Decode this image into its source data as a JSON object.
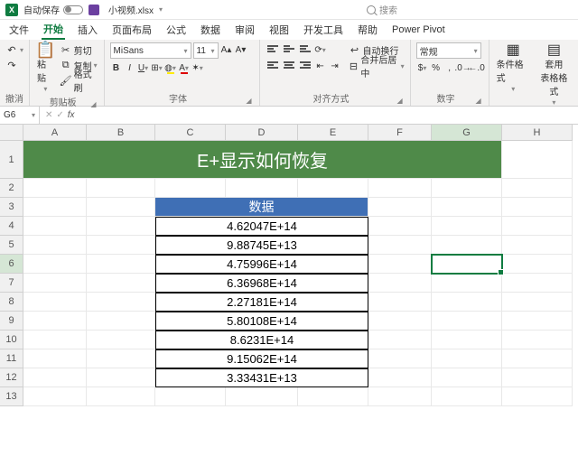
{
  "title": {
    "autosave_label": "自动保存",
    "filename": "小视频.xlsx",
    "search_placeholder": "搜索"
  },
  "tabs": {
    "file": "文件",
    "home": "开始",
    "insert": "插入",
    "layout": "页面布局",
    "formulas": "公式",
    "data": "数据",
    "review": "审阅",
    "view": "视图",
    "dev": "开发工具",
    "help": "帮助",
    "powerpivot": "Power Pivot"
  },
  "ribbon": {
    "undo_group": "撤消",
    "clipboard_group": "剪贴板",
    "paste": "粘贴",
    "cut": "剪切",
    "copy": "复制",
    "format_painter": "格式刷",
    "font_group": "字体",
    "font_name": "MiSans",
    "font_size": "11",
    "align_group": "对齐方式",
    "wrap": "自动换行",
    "merge": "合并后居中",
    "number_group": "数字",
    "number_format": "常规",
    "cond_fmt": "条件格式",
    "table_fmt": "套用\n表格格式"
  },
  "formula": {
    "cell_ref": "G6"
  },
  "columns": [
    "A",
    "B",
    "C",
    "D",
    "E",
    "F",
    "G",
    "H"
  ],
  "rows": [
    "1",
    "2",
    "3",
    "4",
    "5",
    "6",
    "7",
    "8",
    "9",
    "10",
    "11",
    "12",
    "13"
  ],
  "sheet": {
    "banner": "E+显示如何恢复",
    "data_header": "数据",
    "data_values": [
      "4.62047E+14",
      "9.88745E+13",
      "4.75996E+14",
      "6.36968E+14",
      "2.27181E+14",
      "5.80108E+14",
      "8.6231E+14",
      "9.15062E+14",
      "3.33431E+13"
    ],
    "selected": "G6"
  }
}
